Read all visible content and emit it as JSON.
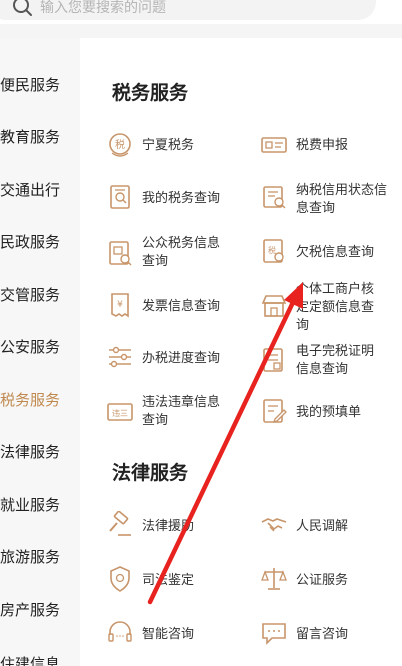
{
  "search": {
    "placeholder": "输入您要搜索的问题"
  },
  "sidebar": {
    "items": [
      {
        "label": "便民服务"
      },
      {
        "label": "教育服务"
      },
      {
        "label": "交通出行"
      },
      {
        "label": "民政服务"
      },
      {
        "label": "交管服务"
      },
      {
        "label": "公安服务"
      },
      {
        "label": "税务服务",
        "active": true
      },
      {
        "label": "法律服务"
      },
      {
        "label": "就业服务"
      },
      {
        "label": "旅游服务"
      },
      {
        "label": "房产服务"
      },
      {
        "label": "住建信息"
      }
    ]
  },
  "sections": {
    "tax": {
      "title": "税务服务",
      "items": [
        {
          "label": "宁夏税务",
          "icon": "tax-seal-icon"
        },
        {
          "label": "税费申报",
          "icon": "tax-declare-icon"
        },
        {
          "label": "我的税务查询",
          "icon": "document-search-icon"
        },
        {
          "label": "纳税信用状态信息查询",
          "icon": "credit-check-icon"
        },
        {
          "label": "公众税务信息查询",
          "icon": "public-info-icon"
        },
        {
          "label": "欠税信息查询",
          "icon": "tax-debt-icon"
        },
        {
          "label": "发票信息查询",
          "icon": "invoice-icon"
        },
        {
          "label": "个体工商户核定定额信息查询",
          "icon": "shop-icon"
        },
        {
          "label": "办税进度查询",
          "icon": "progress-sliders-icon"
        },
        {
          "label": "电子完税证明信息查询",
          "icon": "tax-certificate-icon"
        },
        {
          "label": "违法违章信息查询",
          "icon": "violation-icon"
        },
        {
          "label": "我的预填单",
          "icon": "prefill-form-icon"
        }
      ]
    },
    "law": {
      "title": "法律服务",
      "items": [
        {
          "label": "法律援助",
          "icon": "gavel-icon"
        },
        {
          "label": "人民调解",
          "icon": "handshake-icon"
        },
        {
          "label": "司法鉴定",
          "icon": "badge-icon"
        },
        {
          "label": "公证服务",
          "icon": "scales-icon"
        },
        {
          "label": "智能咨询",
          "icon": "headset-icon"
        },
        {
          "label": "留言咨询",
          "icon": "message-icon"
        }
      ]
    }
  },
  "colors": {
    "accent": "#c0894f",
    "icon": "#c8956a",
    "arrow": "#e8231f"
  }
}
